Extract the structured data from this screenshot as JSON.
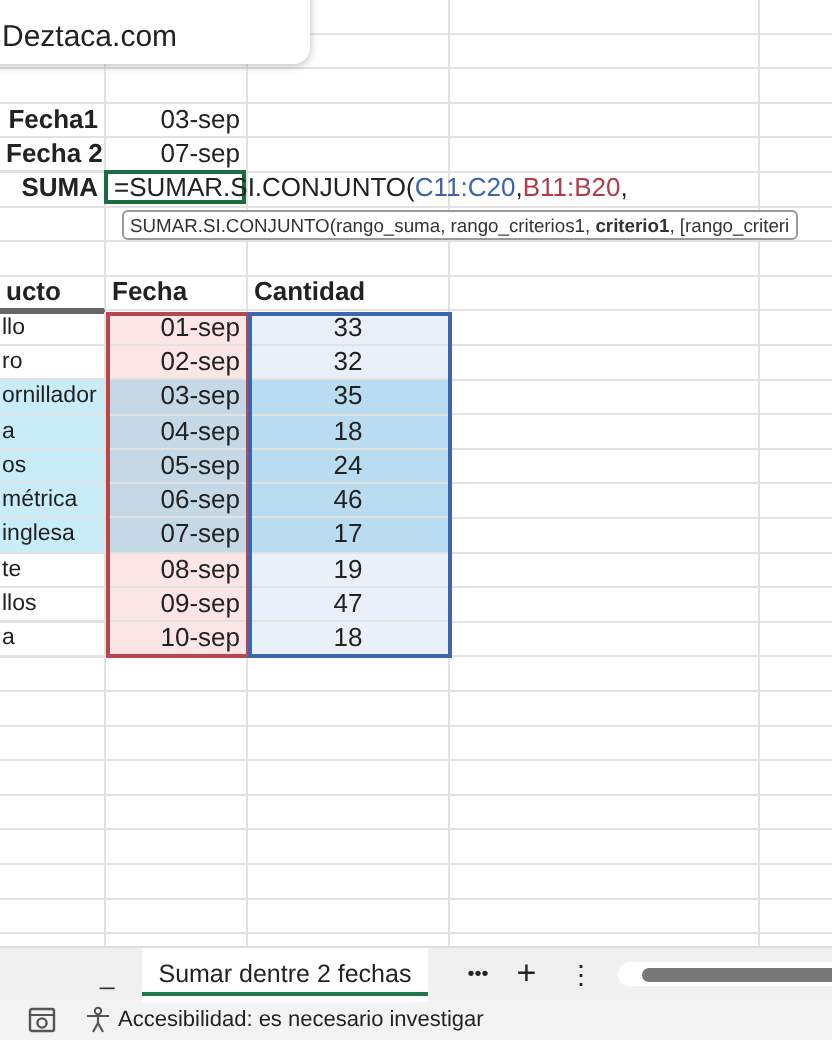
{
  "brand": {
    "text": "Deztaca.com"
  },
  "params": [
    {
      "label": "Fecha1",
      "value": "03-sep"
    },
    {
      "label": "Fecha 2",
      "value": "07-sep"
    }
  ],
  "formula": {
    "label": "SUMA",
    "parts": [
      {
        "text": "=SUMAR.SI.CONJUNTO(",
        "kind": "plain"
      },
      {
        "text": "C11:C20",
        "kind": "ref",
        "color": "#3a62b5",
        "suffix": ","
      },
      {
        "text": "B11:B20",
        "kind": "ref",
        "color": "#b33a4a",
        "suffix": ","
      }
    ],
    "tooltip": "SUMAR.SI.CONJUNTO(rango_suma, rango_criterios1, **criterio1**, [rango_criteri"
  },
  "table": {
    "columns": [
      "ucto",
      "Fecha",
      "Cantidad"
    ],
    "rows": [
      {
        "product": "llo",
        "date": "01-sep",
        "qty": "33",
        "highlighted": false
      },
      {
        "product": "ro",
        "date": "02-sep",
        "qty": "32",
        "highlighted": false
      },
      {
        "product": "ornillador",
        "date": "03-sep",
        "qty": "35",
        "highlighted": true
      },
      {
        "product": "a",
        "date": "04-sep",
        "qty": "18",
        "highlighted": true
      },
      {
        "product": "os",
        "date": "05-sep",
        "qty": "24",
        "highlighted": true
      },
      {
        "product": "métrica",
        "date": "06-sep",
        "qty": "46",
        "highlighted": true
      },
      {
        "product": "inglesa",
        "date": "07-sep",
        "qty": "17",
        "highlighted": true
      },
      {
        "product": "te",
        "date": "08-sep",
        "qty": "19",
        "highlighted": false
      },
      {
        "product": "llos",
        "date": "09-sep",
        "qty": "47",
        "highlighted": false
      },
      {
        "product": "a",
        "date": "10-sep",
        "qty": "18",
        "highlighted": false
      }
    ]
  },
  "sheet_bar": {
    "left_mark": "_",
    "tabs": [
      {
        "label": "Sumar dentre 2 fechas",
        "selected": true
      }
    ],
    "more": "•••",
    "add": "+",
    "options": "⋮"
  },
  "status_bar": {
    "accessibility": "Accesibilidad: es necesario investigar"
  }
}
